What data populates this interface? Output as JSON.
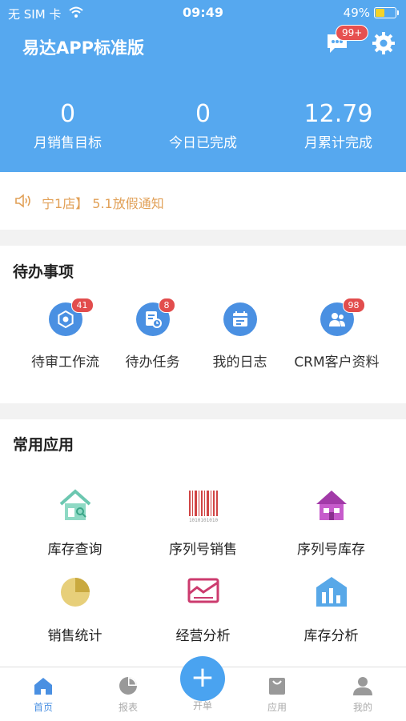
{
  "status_bar": {
    "carrier": "无 SIM 卡",
    "time": "09:49",
    "battery": "49%"
  },
  "header": {
    "title": "易达APP标准版",
    "message_badge": "99+",
    "stats": [
      {
        "value": "0",
        "label": "月销售目标"
      },
      {
        "value": "0",
        "label": "今日已完成"
      },
      {
        "value": "12.79",
        "label": "月累计完成"
      }
    ]
  },
  "notice": {
    "text": "宁1店】 5.1放假通知"
  },
  "todo": {
    "title": "待办事项",
    "items": [
      {
        "label": "待审工作流",
        "count": "41"
      },
      {
        "label": "待办任务",
        "count": "8"
      },
      {
        "label": "我的日志",
        "count": ""
      },
      {
        "label": "CRM客户资料",
        "count": "98"
      }
    ]
  },
  "apps": {
    "title": "常用应用",
    "items": [
      {
        "label": "库存查询",
        "icon": "house-search-icon"
      },
      {
        "label": "序列号销售",
        "icon": "barcode-icon"
      },
      {
        "label": "序列号库存",
        "icon": "purple-house-icon"
      },
      {
        "label": "销售统计",
        "icon": "pie-chart-icon"
      },
      {
        "label": "经营分析",
        "icon": "analysis-chart-icon"
      },
      {
        "label": "库存分析",
        "icon": "warehouse-chart-icon"
      }
    ],
    "barcode_caption": "1010101010"
  },
  "tabbar": {
    "items": [
      {
        "label": "首页",
        "active": true
      },
      {
        "label": "报表"
      },
      {
        "label": "开单"
      },
      {
        "label": "应用"
      },
      {
        "label": "我的"
      }
    ]
  },
  "colors": {
    "header": "#56a8ef",
    "accent": "#4a90e2",
    "badge": "#e24d4d",
    "notice": "#e1a057"
  }
}
